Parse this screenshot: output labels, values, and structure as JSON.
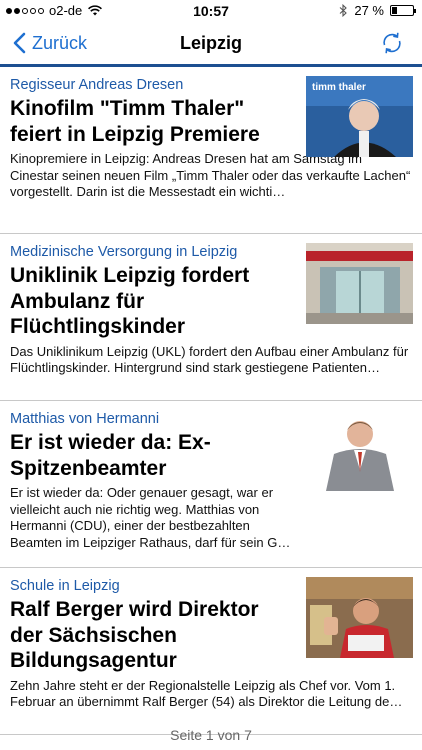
{
  "status": {
    "carrier": "o2-de",
    "time": "10:57",
    "battery": "27 %",
    "battery_level": 0.27
  },
  "nav": {
    "back_label": "Zurück",
    "title": "Leipzig"
  },
  "articles": [
    {
      "kicker": "Regisseur Andreas Dresen",
      "headline": "Kinofilm \"Timm Thaler\" feiert in Leipzig Premiere",
      "teaser": "Kinopremiere in Leipzig: Andreas Dresen hat am Samstag im Cinestar seinen neuen Film „Timm Thaler oder das verkaufte Lachen“ vorgestellt. Darin ist die Messestadt ein wichti…",
      "image_text": "timm thaler"
    },
    {
      "kicker": "Medizinische Versorgung in Leipzig",
      "headline": "Uniklinik Leipzig fordert Ambulanz für Flüchtlingskinder",
      "teaser": "Das Uniklinikum Leipzig (UKL) fordert den Aufbau einer Ambulanz für Flüchtlingskinder. Hintergrund sind stark gestiegene Patienten…"
    },
    {
      "kicker": "Matthias von Hermanni",
      "headline": "Er ist wieder da: Ex-Spitzenbeamter",
      "teaser": "Er ist wieder da: Oder genauer gesagt, war er vielleicht auch nie richtig weg. Matthias von Hermanni (CDU), einer der bestbezahlten Beamten im Leipziger Rathaus, darf für sein G…"
    },
    {
      "kicker": "Schule in Leipzig",
      "headline": "Ralf Berger wird Direktor der Sächsischen Bildungsagentur",
      "teaser": "Zehn Jahre steht er der Regionalstelle Leipzig als Chef vor. Vom 1. Februar an übernimmt Ralf Berger (54) als Direktor die Leitung de…"
    }
  ],
  "pager": {
    "label": "Seite 1 von 7"
  },
  "colors": {
    "accent": "#1e6fd0",
    "kicker": "#1e5aa8",
    "nav_line": "#1d4f91"
  }
}
